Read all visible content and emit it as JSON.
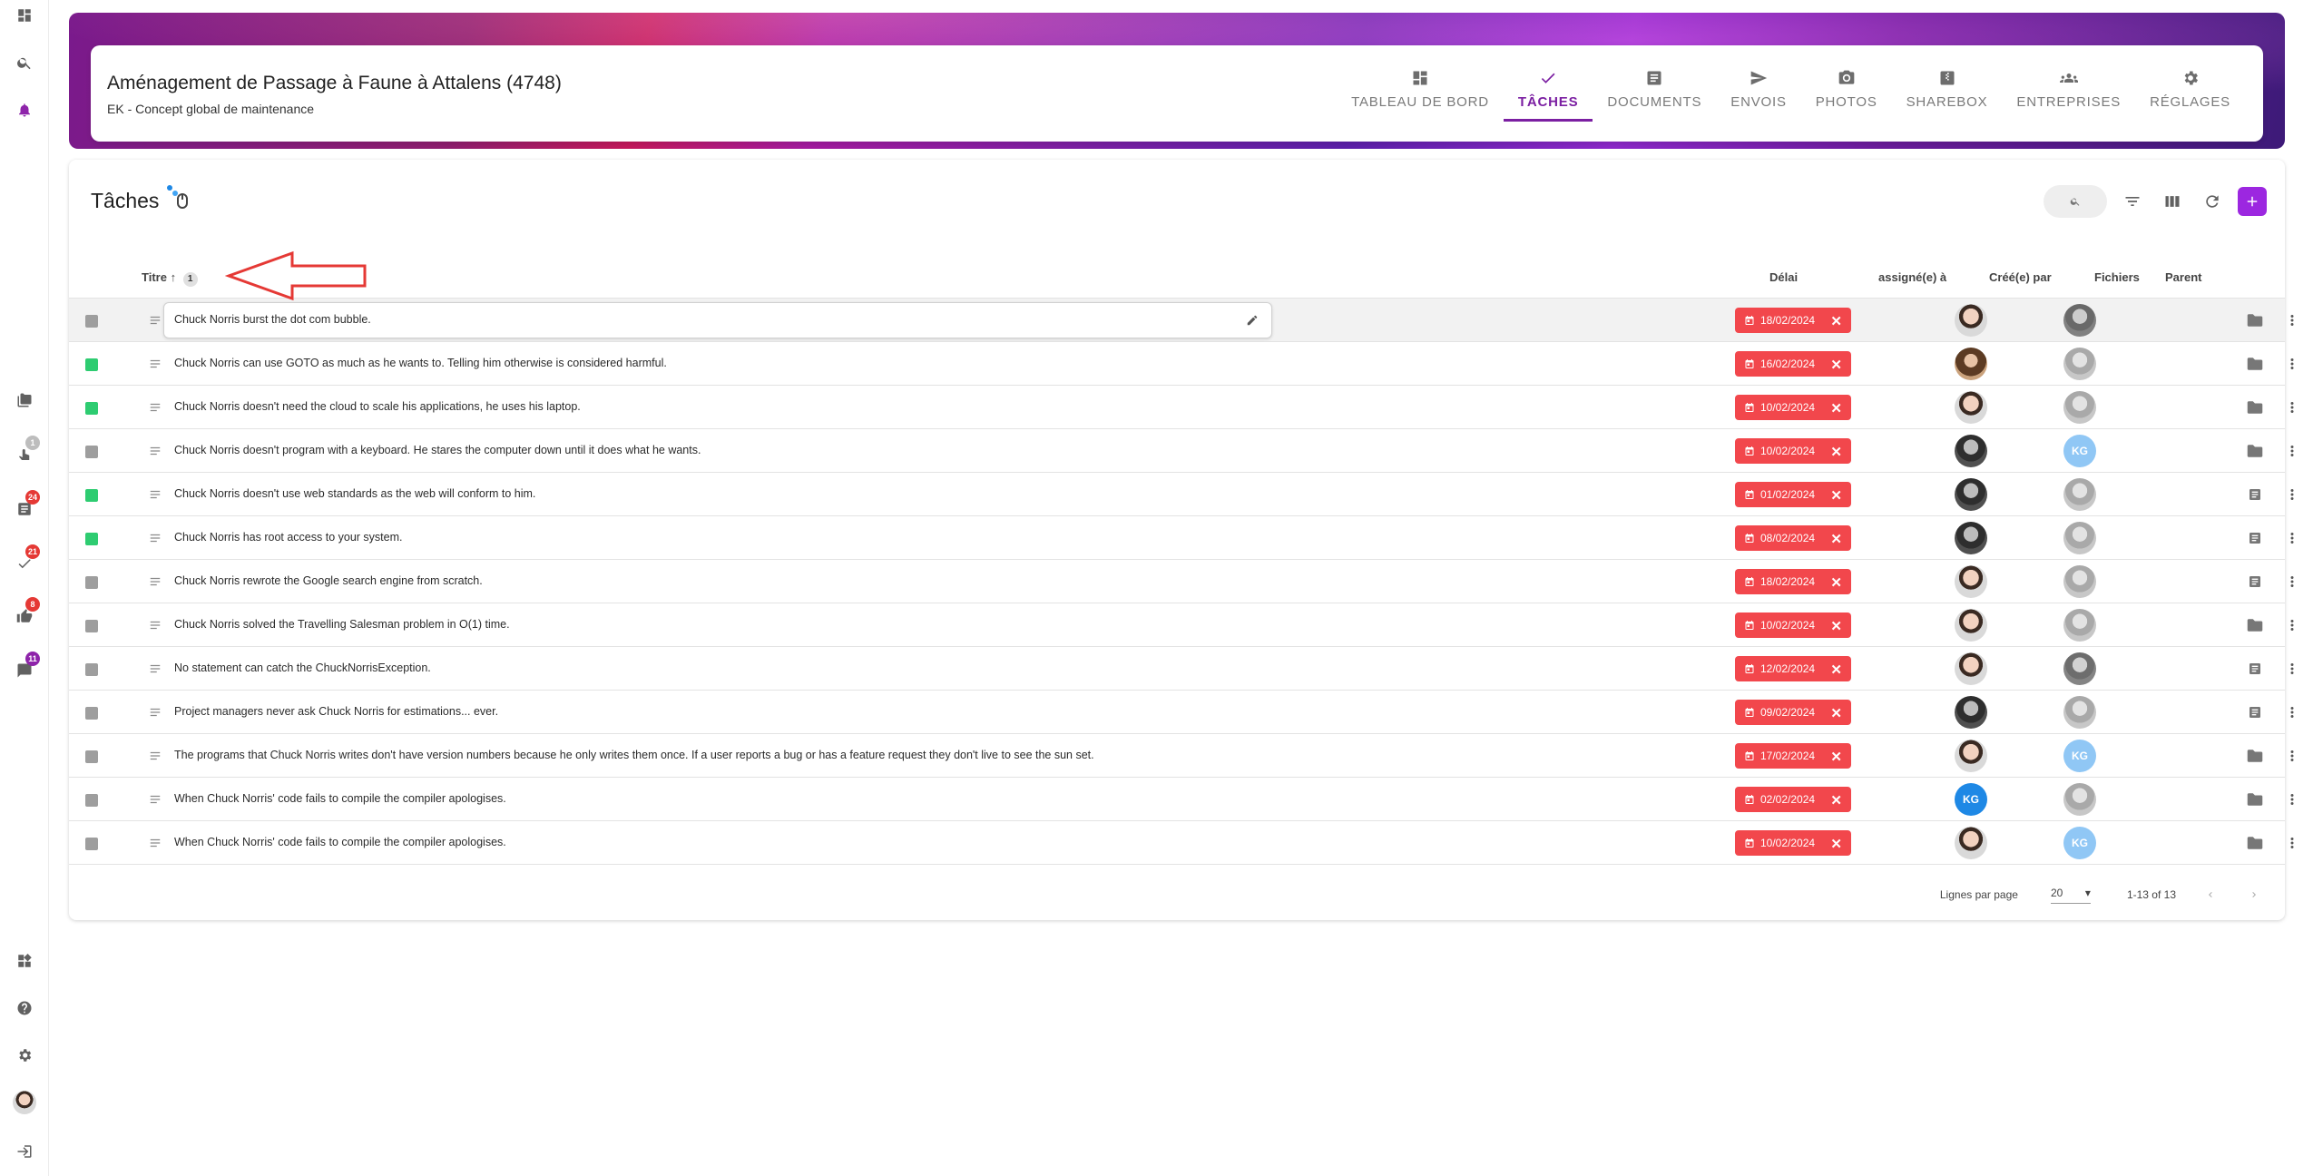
{
  "project": {
    "title": "Aménagement de Passage à Faune à Attalens (4748)",
    "subtitle": "EK - Concept global de maintenance"
  },
  "nav_tabs": [
    {
      "label": "TABLEAU DE BORD",
      "icon": "dashboard-icon"
    },
    {
      "label": "TÂCHES",
      "icon": "check-icon",
      "active": true
    },
    {
      "label": "DOCUMENTS",
      "icon": "document-icon"
    },
    {
      "label": "ENVOIS",
      "icon": "send-icon"
    },
    {
      "label": "PHOTOS",
      "icon": "camera-icon"
    },
    {
      "label": "SHAREBOX",
      "icon": "sharebox-icon"
    },
    {
      "label": "ENTREPRISES",
      "icon": "people-icon"
    },
    {
      "label": "RÉGLAGES",
      "icon": "gear-icon"
    }
  ],
  "rail": {
    "badges": {
      "contacts": "1",
      "documents": "24",
      "tasks": "21",
      "likes": "8",
      "messages": "11"
    }
  },
  "tasks": {
    "title": "Tâches",
    "columns": {
      "title": "Titre",
      "sort_count": "1",
      "deadline": "Délai",
      "assignee": "assigné(e) à",
      "creator": "Créé(e) par",
      "files": "Fichiers",
      "parent": "Parent"
    },
    "rows": [
      {
        "status": "open",
        "title": "Chuck Norris burst the dot com bubble.",
        "deadline": "18/02/2024",
        "assignee": "photo",
        "creator": "dark-grey",
        "parent": "folder"
      },
      {
        "status": "done",
        "title": "Chuck Norris can use GOTO as much as he wants to. Telling him otherwise is considered harmful.",
        "deadline": "16/02/2024",
        "assignee": "woman",
        "creator": "grey",
        "parent": "folder"
      },
      {
        "status": "done",
        "title": "Chuck Norris doesn't need the cloud to scale his applications, he uses his laptop.",
        "deadline": "10/02/2024",
        "assignee": "photo",
        "creator": "grey",
        "parent": "folder"
      },
      {
        "status": "open",
        "title": "Chuck Norris doesn't program with a keyboard. He stares the computer down until it does what he wants.",
        "deadline": "10/02/2024",
        "assignee": "dark",
        "creator": "KG",
        "parent": "folder"
      },
      {
        "status": "done",
        "title": "Chuck Norris doesn't use web standards as the web will conform to him.",
        "deadline": "01/02/2024",
        "assignee": "dark",
        "creator": "grey",
        "parent": "doc"
      },
      {
        "status": "done",
        "title": "Chuck Norris has root access to your system.",
        "deadline": "08/02/2024",
        "assignee": "dark",
        "creator": "grey",
        "parent": "doc"
      },
      {
        "status": "open",
        "title": "Chuck Norris rewrote the Google search engine from scratch.",
        "deadline": "18/02/2024",
        "assignee": "photo",
        "creator": "grey",
        "parent": "doc"
      },
      {
        "status": "open",
        "title": "Chuck Norris solved the Travelling Salesman problem in O(1) time.",
        "deadline": "10/02/2024",
        "assignee": "photo",
        "creator": "grey",
        "parent": "folder"
      },
      {
        "status": "open",
        "title": "No statement can catch the ChuckNorrisException.",
        "deadline": "12/02/2024",
        "assignee": "photo",
        "creator": "dark-grey",
        "parent": "doc"
      },
      {
        "status": "open",
        "title": "Project managers never ask Chuck Norris for estimations... ever.",
        "deadline": "09/02/2024",
        "assignee": "dark",
        "creator": "grey",
        "parent": "doc"
      },
      {
        "status": "open",
        "title": "The programs that Chuck Norris writes don't have version numbers because he only writes them once. If a user reports a bug or has a feature request they don't live to see the sun set.",
        "deadline": "17/02/2024",
        "assignee": "photo",
        "creator": "KG",
        "parent": "folder"
      },
      {
        "status": "open",
        "title": "When Chuck Norris' code fails to compile the compiler apologises.",
        "deadline": "02/02/2024",
        "assignee": "KG-strong",
        "creator": "grey",
        "parent": "folder"
      },
      {
        "status": "open",
        "title": "When Chuck Norris' code fails to compile the compiler apologises.",
        "deadline": "10/02/2024",
        "assignee": "photo",
        "creator": "KG",
        "parent": "folder"
      }
    ],
    "pagination": {
      "rows_per_page_label": "Lignes par page",
      "rows_per_page": "20",
      "range": "1-13 of 13"
    }
  },
  "colors": {
    "accent": "#7b1fa2",
    "add_button": "#9c27e0",
    "deadline_bg": "#f2474c",
    "done": "#2ecc71",
    "open": "#9e9e9e",
    "annotation": "#e53935"
  }
}
